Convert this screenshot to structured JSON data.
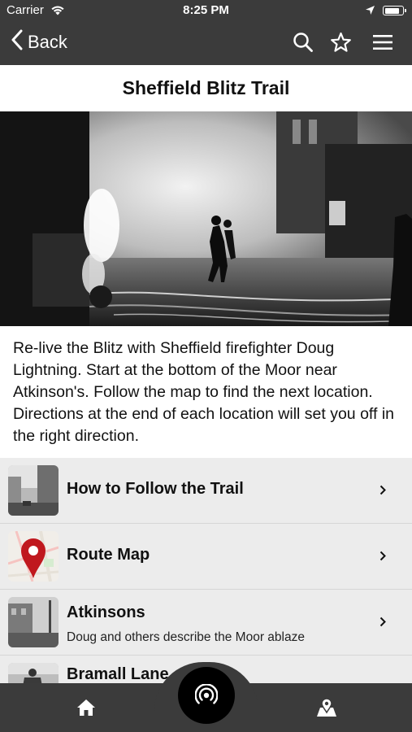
{
  "status_bar": {
    "carrier": "Carrier",
    "time": "8:25 PM",
    "battery_level": 0.85
  },
  "nav": {
    "back_label": "Back",
    "icons": [
      "search-icon",
      "star-icon",
      "menu-icon"
    ]
  },
  "page": {
    "title": "Sheffield Blitz Trail",
    "description": "Re-live the Blitz with Sheffield firefighter Doug Lightning. Start at the bottom of the Moor near Atkinson's. Follow the map to find the next location. Directions at the end of each location will set you off in the right direction."
  },
  "items": [
    {
      "title": "How to Follow the Trail",
      "subtitle": ""
    },
    {
      "title": "Route Map",
      "subtitle": ""
    },
    {
      "title": "Atkinsons",
      "subtitle": "Doug and others describe the Moor ablaze"
    },
    {
      "title": "Bramall Lane",
      "subtitle": ""
    }
  ],
  "tab_bar": {
    "icons": [
      "home-icon",
      "beacon-icon",
      "map-icon"
    ]
  },
  "colors": {
    "bar_background": "#3b3b3b",
    "list_background": "#ececec",
    "pin_red": "#c0181e"
  }
}
